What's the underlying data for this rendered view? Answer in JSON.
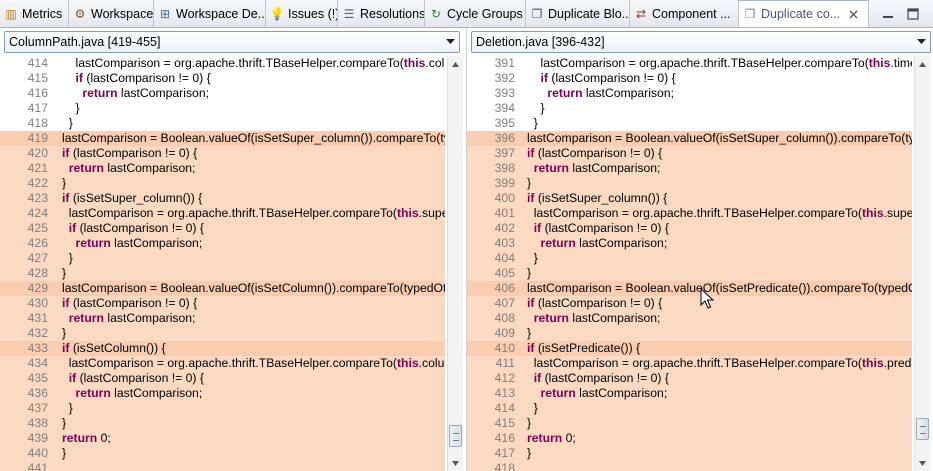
{
  "tabs": [
    {
      "label": "Metrics",
      "icon": "metrics-icon",
      "glyph": "▥",
      "color": "#c08020",
      "width": 69
    },
    {
      "label": "Workspace",
      "icon": "workspace-icon",
      "glyph": "⚙",
      "color": "#7a5a30",
      "width": 85
    },
    {
      "label": "Workspace De...",
      "icon": "workspace-dependencies-icon",
      "glyph": "⊞",
      "color": "#4a6a9a",
      "width": 112
    },
    {
      "label": "Issues (!)",
      "icon": "lightbulb-icon",
      "glyph": "💡",
      "color": "#d8a000",
      "width": 72
    },
    {
      "label": "Resolutions",
      "icon": "resolutions-icon",
      "glyph": "☰",
      "color": "#506070",
      "width": 87
    },
    {
      "label": "Cycle Groups",
      "icon": "cycle-groups-icon",
      "glyph": "↻",
      "color": "#2a8a3a",
      "width": 101
    },
    {
      "label": "Duplicate Blo...",
      "icon": "duplicate-blocks-icon",
      "glyph": "❐",
      "color": "#3a5a8a",
      "width": 104
    },
    {
      "label": "Component ...",
      "icon": "component-icon",
      "glyph": "⇄",
      "color": "#a03030",
      "width": 109
    },
    {
      "label": "Duplicate co...",
      "icon": "duplicate-code-icon",
      "glyph": "❐",
      "color": "#7a8aa0",
      "width": 130,
      "active": true
    }
  ],
  "colors": {
    "keyword": "#7f0055",
    "highlight": "#fcd9c2",
    "highlight_strong": "#fbcdb0",
    "line_number": "#7f7f7f"
  },
  "left": {
    "file": "ColumnPath.java [419-455]",
    "lines": [
      {
        "n": "414",
        "text": "    lastComparison = org.apache.thrift.TBaseHelper.compareTo(this.colum",
        "hl": ""
      },
      {
        "n": "415",
        "text": "    if (lastComparison != 0) {",
        "hl": ""
      },
      {
        "n": "416",
        "text": "      return lastComparison;",
        "hl": ""
      },
      {
        "n": "417",
        "text": "    }",
        "hl": ""
      },
      {
        "n": "418",
        "text": "  }",
        "hl": ""
      },
      {
        "n": "419",
        "text": "lastComparison = Boolean.valueOf(isSetSuper_column()).compareTo(typ",
        "hl": "hl2"
      },
      {
        "n": "420",
        "text": "if (lastComparison != 0) {",
        "hl": "hl"
      },
      {
        "n": "421",
        "text": "  return lastComparison;",
        "hl": "hl"
      },
      {
        "n": "422",
        "text": "}",
        "hl": "hl"
      },
      {
        "n": "423",
        "text": "if (isSetSuper_column()) {",
        "hl": "hl"
      },
      {
        "n": "424",
        "text": "  lastComparison = org.apache.thrift.TBaseHelper.compareTo(this.super_",
        "hl": "hl"
      },
      {
        "n": "425",
        "text": "  if (lastComparison != 0) {",
        "hl": "hl"
      },
      {
        "n": "426",
        "text": "    return lastComparison;",
        "hl": "hl"
      },
      {
        "n": "427",
        "text": "  }",
        "hl": "hl"
      },
      {
        "n": "428",
        "text": "}",
        "hl": "hl"
      },
      {
        "n": "429",
        "text": "lastComparison = Boolean.valueOf(isSetColumn()).compareTo(typedOth",
        "hl": "hl2"
      },
      {
        "n": "430",
        "text": "if (lastComparison != 0) {",
        "hl": "hl"
      },
      {
        "n": "431",
        "text": "  return lastComparison;",
        "hl": "hl"
      },
      {
        "n": "432",
        "text": "}",
        "hl": "hl"
      },
      {
        "n": "433",
        "text": "if (isSetColumn()) {",
        "hl": "hl2"
      },
      {
        "n": "434",
        "text": "  lastComparison = org.apache.thrift.TBaseHelper.compareTo(this.colum",
        "hl": "hl"
      },
      {
        "n": "435",
        "text": "  if (lastComparison != 0) {",
        "hl": "hl"
      },
      {
        "n": "436",
        "text": "    return lastComparison;",
        "hl": "hl"
      },
      {
        "n": "437",
        "text": "  }",
        "hl": "hl"
      },
      {
        "n": "438",
        "text": "}",
        "hl": "hl"
      },
      {
        "n": "439",
        "text": "return 0;",
        "hl": "hl"
      },
      {
        "n": "440",
        "text": "}",
        "hl": "hl"
      },
      {
        "n": "441",
        "text": "",
        "hl": "hl"
      }
    ]
  },
  "right": {
    "file": "Deletion.java [396-432]",
    "lines": [
      {
        "n": "391",
        "text": "    lastComparison = org.apache.thrift.TBaseHelper.compareTo(this.timest",
        "hl": ""
      },
      {
        "n": "392",
        "text": "    if (lastComparison != 0) {",
        "hl": ""
      },
      {
        "n": "393",
        "text": "      return lastComparison;",
        "hl": ""
      },
      {
        "n": "394",
        "text": "    }",
        "hl": ""
      },
      {
        "n": "395",
        "text": "  }",
        "hl": ""
      },
      {
        "n": "396",
        "text": "lastComparison = Boolean.valueOf(isSetSuper_column()).compareTo(typ",
        "hl": "hl2"
      },
      {
        "n": "397",
        "text": "if (lastComparison != 0) {",
        "hl": "hl"
      },
      {
        "n": "398",
        "text": "  return lastComparison;",
        "hl": "hl"
      },
      {
        "n": "399",
        "text": "}",
        "hl": "hl"
      },
      {
        "n": "400",
        "text": "if (isSetSuper_column()) {",
        "hl": "hl"
      },
      {
        "n": "401",
        "text": "  lastComparison = org.apache.thrift.TBaseHelper.compareTo(this.super_",
        "hl": "hl"
      },
      {
        "n": "402",
        "text": "  if (lastComparison != 0) {",
        "hl": "hl"
      },
      {
        "n": "403",
        "text": "    return lastComparison;",
        "hl": "hl"
      },
      {
        "n": "404",
        "text": "  }",
        "hl": "hl"
      },
      {
        "n": "405",
        "text": "}",
        "hl": "hl"
      },
      {
        "n": "406",
        "text": "lastComparison = Boolean.valueOf(isSetPredicate()).compareTo(typedOt",
        "hl": "hl2"
      },
      {
        "n": "407",
        "text": "if (lastComparison != 0) {",
        "hl": "hl"
      },
      {
        "n": "408",
        "text": "  return lastComparison;",
        "hl": "hl"
      },
      {
        "n": "409",
        "text": "}",
        "hl": "hl"
      },
      {
        "n": "410",
        "text": "if (isSetPredicate()) {",
        "hl": "hl2"
      },
      {
        "n": "411",
        "text": "  lastComparison = org.apache.thrift.TBaseHelper.compareTo(this.predic",
        "hl": "hl"
      },
      {
        "n": "412",
        "text": "  if (lastComparison != 0) {",
        "hl": "hl"
      },
      {
        "n": "413",
        "text": "    return lastComparison;",
        "hl": "hl"
      },
      {
        "n": "414",
        "text": "  }",
        "hl": "hl"
      },
      {
        "n": "415",
        "text": "}",
        "hl": "hl"
      },
      {
        "n": "416",
        "text": "return 0;",
        "hl": "hl"
      },
      {
        "n": "417",
        "text": "}",
        "hl": "hl"
      },
      {
        "n": "418",
        "text": "",
        "hl": "hl"
      }
    ]
  }
}
